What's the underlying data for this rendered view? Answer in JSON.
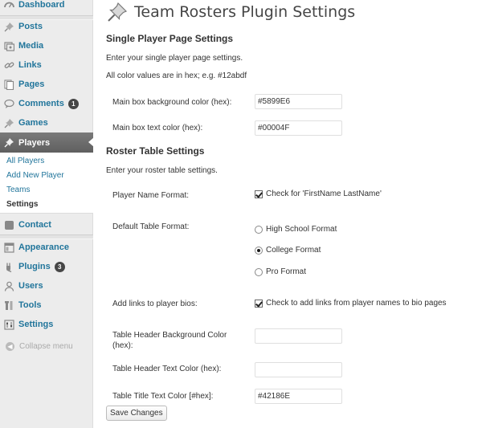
{
  "sidebar": {
    "items": [
      {
        "label": "Dashboard",
        "icon": "dashboard-icon"
      },
      {
        "label": "Posts",
        "icon": "pushpin-icon"
      },
      {
        "label": "Media",
        "icon": "media-icon"
      },
      {
        "label": "Links",
        "icon": "link-icon"
      },
      {
        "label": "Pages",
        "icon": "pages-icon"
      },
      {
        "label": "Comments",
        "icon": "comment-icon",
        "badge": "1"
      },
      {
        "label": "Games",
        "icon": "pushpin-icon"
      },
      {
        "label": "Players",
        "icon": "pushpin-icon"
      },
      {
        "label": "Contact",
        "icon": "contact-icon"
      },
      {
        "label": "Appearance",
        "icon": "appearance-icon"
      },
      {
        "label": "Plugins",
        "icon": "plugin-icon",
        "badge": "3"
      },
      {
        "label": "Users",
        "icon": "users-icon"
      },
      {
        "label": "Tools",
        "icon": "tools-icon"
      },
      {
        "label": "Settings",
        "icon": "settings-icon"
      }
    ],
    "submenu": [
      "All Players",
      "Add New Player",
      "Teams",
      "Settings"
    ],
    "collapse_label": "Collapse menu"
  },
  "page": {
    "title": "Team Rosters Plugin Settings",
    "section1": {
      "heading": "Single Player Page Settings",
      "intro": "Enter your single player page settings.",
      "note": "All color values are in hex; e.g. #12abdf",
      "bg_color_label": "Main box background color (hex):",
      "bg_color_value": "#5899E6",
      "text_color_label": "Main box text color (hex):",
      "text_color_value": "#00004F"
    },
    "section2": {
      "heading": "Roster Table Settings",
      "intro": "Enter your roster table settings.",
      "name_format_label": "Player Name Format:",
      "name_format_check": "Check for 'FirstName LastName'",
      "default_format_label": "Default Table Format:",
      "formats": [
        "High School Format",
        "College Format",
        "Pro Format"
      ],
      "selected_format": "College Format",
      "links_label": "Add links to player bios:",
      "links_check": "Check to add links from player names to bio pages",
      "header_bg_label_1": "Table Header Background Color",
      "header_bg_label_2": "(hex):",
      "header_bg_value": "",
      "header_text_label": "Table Header Text Color (hex):",
      "header_text_value": "",
      "title_text_label": "Table Title Text Color [#hex]:",
      "title_text_value": "#42186E"
    },
    "save_label": "Save Changes"
  }
}
